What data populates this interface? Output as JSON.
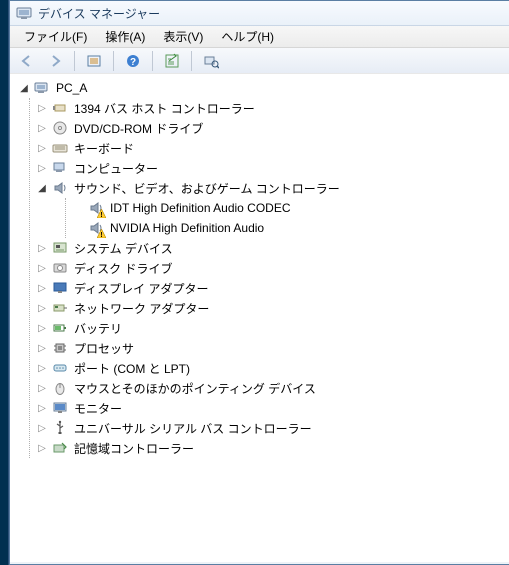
{
  "window": {
    "title": "デバイス マネージャー"
  },
  "menu": {
    "file": "ファイル(F)",
    "action": "操作(A)",
    "view": "表示(V)",
    "help": "ヘルプ(H)"
  },
  "toolbar": {
    "back": "back-icon",
    "forward": "forward-icon",
    "detail": "detail-icon",
    "help": "help-icon",
    "list": "list-icon",
    "scan": "scan-icon"
  },
  "tree": {
    "root": {
      "label": "PC_A",
      "expanded": true
    },
    "items": [
      {
        "label": "1394 バス ホスト コントローラー",
        "icon": "ieee1394",
        "expanded": false
      },
      {
        "label": "DVD/CD-ROM ドライブ",
        "icon": "disc",
        "expanded": false
      },
      {
        "label": "キーボード",
        "icon": "keyboard",
        "expanded": false
      },
      {
        "label": "コンピューター",
        "icon": "computer",
        "expanded": false
      },
      {
        "label": "サウンド、ビデオ、およびゲーム コントローラー",
        "icon": "sound",
        "expanded": true,
        "children": [
          {
            "label": "IDT High Definition Audio CODEC",
            "icon": "sound",
            "warn": true
          },
          {
            "label": "NVIDIA High Definition Audio",
            "icon": "sound",
            "warn": true
          }
        ]
      },
      {
        "label": "システム デバイス",
        "icon": "system",
        "expanded": false
      },
      {
        "label": "ディスク ドライブ",
        "icon": "diskdrive",
        "expanded": false
      },
      {
        "label": "ディスプレイ アダプター",
        "icon": "display",
        "expanded": false
      },
      {
        "label": "ネットワーク アダプター",
        "icon": "network",
        "expanded": false
      },
      {
        "label": "バッテリ",
        "icon": "battery",
        "expanded": false
      },
      {
        "label": "プロセッサ",
        "icon": "cpu",
        "expanded": false
      },
      {
        "label": "ポート (COM と LPT)",
        "icon": "port",
        "expanded": false
      },
      {
        "label": "マウスとそのほかのポインティング デバイス",
        "icon": "mouse",
        "expanded": false
      },
      {
        "label": "モニター",
        "icon": "monitor",
        "expanded": false
      },
      {
        "label": "ユニバーサル シリアル バス コントローラー",
        "icon": "usb",
        "expanded": false
      },
      {
        "label": "記憶域コントローラー",
        "icon": "storage",
        "expanded": false
      }
    ]
  }
}
